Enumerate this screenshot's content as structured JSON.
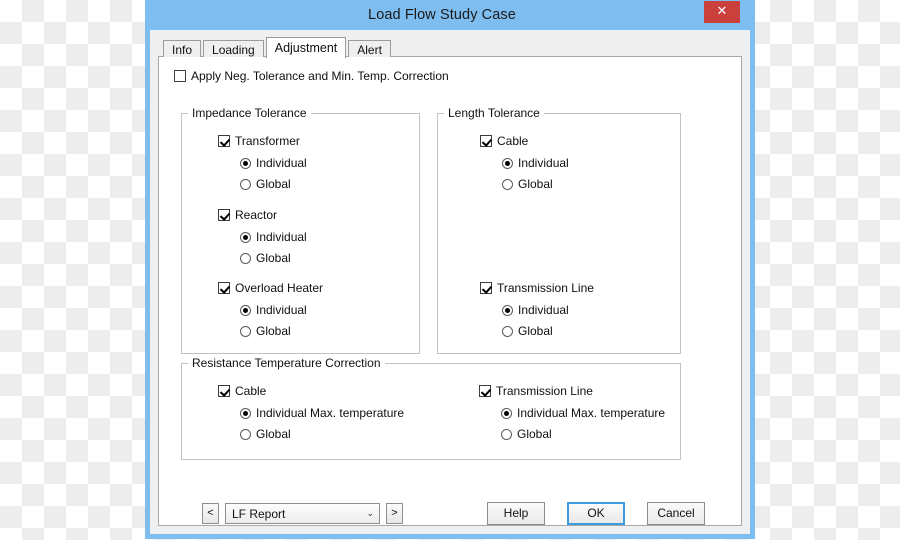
{
  "window": {
    "title": "Load Flow Study Case",
    "close_label": "✕",
    "accent_color": "#7dbdf0",
    "close_color": "#c9403c"
  },
  "tabs": [
    {
      "label": "Info",
      "active": false
    },
    {
      "label": "Loading",
      "active": false
    },
    {
      "label": "Adjustment",
      "active": true
    },
    {
      "label": "Alert",
      "active": false
    }
  ],
  "apply_option": {
    "label": "Apply Neg. Tolerance and Min. Temp. Correction",
    "checked": false
  },
  "groups": {
    "impedance": {
      "title": "Impedance Tolerance",
      "items": [
        {
          "label": "Transformer",
          "checked": true,
          "options": [
            {
              "label": "Individual",
              "selected": true
            },
            {
              "label": "Global",
              "selected": false
            }
          ]
        },
        {
          "label": "Reactor",
          "checked": true,
          "options": [
            {
              "label": "Individual",
              "selected": true
            },
            {
              "label": "Global",
              "selected": false
            }
          ]
        },
        {
          "label": "Overload Heater",
          "checked": true,
          "options": [
            {
              "label": "Individual",
              "selected": true
            },
            {
              "label": "Global",
              "selected": false
            }
          ]
        }
      ]
    },
    "length": {
      "title": "Length Tolerance",
      "items": [
        {
          "label": "Cable",
          "checked": true,
          "options": [
            {
              "label": "Individual",
              "selected": true
            },
            {
              "label": "Global",
              "selected": false
            }
          ]
        },
        {
          "label": "Transmission Line",
          "checked": true,
          "options": [
            {
              "label": "Individual",
              "selected": true
            },
            {
              "label": "Global",
              "selected": false
            }
          ]
        }
      ]
    },
    "rtc": {
      "title": "Resistance Temperature Correction",
      "items": [
        {
          "label": "Cable",
          "checked": true,
          "options": [
            {
              "label": "Individual Max. temperature",
              "selected": true
            },
            {
              "label": "Global",
              "selected": false
            }
          ]
        },
        {
          "label": "Transmission Line",
          "checked": true,
          "options": [
            {
              "label": "Individual Max. temperature",
              "selected": true
            },
            {
              "label": "Global",
              "selected": false
            }
          ]
        }
      ]
    }
  },
  "footer": {
    "prev_label": "<",
    "next_label": ">",
    "report_value": "LF Report",
    "combo_arrow": "⌄",
    "help_label": "Help",
    "ok_label": "OK",
    "cancel_label": "Cancel"
  }
}
